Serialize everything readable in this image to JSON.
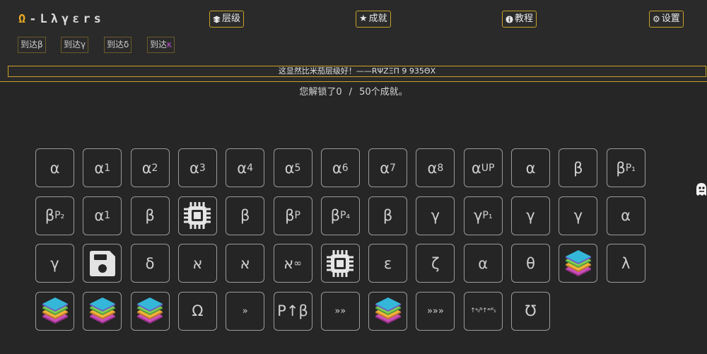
{
  "header": {
    "logo_mark": "Ω",
    "logo_text": "-Lλγεrs",
    "nav": [
      {
        "icon": "layers-icon",
        "label": "层级"
      },
      {
        "icon": "star-icon",
        "label": "成就"
      },
      {
        "icon": "info-icon",
        "label": "教程"
      },
      {
        "icon": "gear-icon",
        "label": "设置"
      }
    ],
    "goto": [
      {
        "label": "到达",
        "greek": "β"
      },
      {
        "label": "到达",
        "greek": "γ"
      },
      {
        "label": "到达",
        "greek": "δ"
      },
      {
        "label": "到达",
        "greek": "κ"
      }
    ],
    "tip": "这显然比米茄层级好！——RΨZΞΠ 9 935ΘX"
  },
  "unlock": {
    "prefix": "您解锁了",
    "current": "0",
    "slash": "/",
    "total": "50",
    "suffix": "个成就。"
  },
  "colors": {
    "accent": "#c9a227",
    "background": "#262626",
    "tile_border": "#9a9a9a"
  },
  "tiles": [
    {
      "t": "α"
    },
    {
      "t": "α",
      "s": "1"
    },
    {
      "t": "α",
      "s": "2"
    },
    {
      "t": "α",
      "s": "3"
    },
    {
      "t": "α",
      "s": "4"
    },
    {
      "t": "α",
      "s": "5"
    },
    {
      "t": "α",
      "s": "6"
    },
    {
      "t": "α",
      "s": "7"
    },
    {
      "t": "α",
      "s": "8"
    },
    {
      "t": "α",
      "s": "UP"
    },
    {
      "t": "α"
    },
    {
      "t": "β"
    },
    {
      "t": "β",
      "s": "P₁"
    },
    {
      "t": "β",
      "s": "P₂"
    },
    {
      "t": "α",
      "s": "1"
    },
    {
      "t": "β"
    },
    {
      "icon": "chip-icon"
    },
    {
      "t": "β"
    },
    {
      "t": "β",
      "s": "P"
    },
    {
      "t": "β",
      "s": "P₄"
    },
    {
      "t": "β"
    },
    {
      "t": "γ"
    },
    {
      "t": "γ",
      "s": "P₁"
    },
    {
      "t": "γ"
    },
    {
      "t": "γ"
    },
    {
      "t": "α"
    },
    {
      "t": "γ"
    },
    {
      "icon": "save-icon"
    },
    {
      "t": "δ"
    },
    {
      "t": "א"
    },
    {
      "t": "א"
    },
    {
      "t": "א",
      "s": "∞"
    },
    {
      "icon": "chip-icon"
    },
    {
      "t": "ε"
    },
    {
      "t": "ζ"
    },
    {
      "t": "α"
    },
    {
      "t": "θ"
    },
    {
      "icon": "layers-stack-icon"
    },
    {
      "t": "λ"
    },
    {
      "icon": "layers-stack-icon"
    },
    {
      "icon": "layers-stack-icon"
    },
    {
      "icon": "layers-stack-icon"
    },
    {
      "t": "Ω"
    },
    {
      "t": "»",
      "cls": "sm"
    },
    {
      "t": "P↑β"
    },
    {
      "t": "»»",
      "cls": "sm"
    },
    {
      "icon": "layers-stack-icon"
    },
    {
      "t": "»»»",
      "cls": "sm"
    },
    {
      "t": "↑ᵃ₀ᴺ↑ᵃᶜᴷ₁",
      "cls": "tiny"
    },
    {
      "t": "Ʊ"
    }
  ]
}
